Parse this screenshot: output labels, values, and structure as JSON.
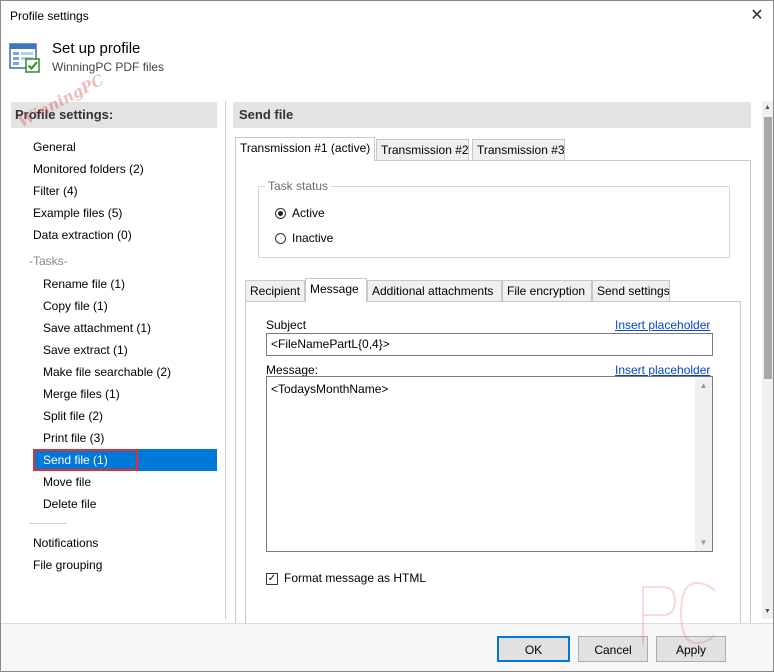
{
  "window": {
    "title": "Profile settings",
    "close_glyph": "✕"
  },
  "header": {
    "title": "Set up profile",
    "subtitle": "WinningPC PDF files",
    "icon": "profile-settings-icon"
  },
  "sidebar": {
    "title": "Profile settings:",
    "watermark": "WinningPC",
    "items": [
      {
        "label": "General"
      },
      {
        "label": "Monitored folders (2)"
      },
      {
        "label": "Filter (4)"
      },
      {
        "label": "Example files (5)"
      },
      {
        "label": "Data extraction (0)"
      }
    ],
    "tasks_label": "-Tasks-",
    "task_items": [
      {
        "label": "Rename file (1)"
      },
      {
        "label": "Copy file (1)"
      },
      {
        "label": "Save attachment (1)"
      },
      {
        "label": "Save extract (1)"
      },
      {
        "label": "Make file searchable (2)"
      },
      {
        "label": "Merge files (1)"
      },
      {
        "label": "Split file (2)"
      },
      {
        "label": "Print file (3)"
      },
      {
        "label": "Send file (1)",
        "selected": true
      },
      {
        "label": "Move file"
      },
      {
        "label": "Delete file"
      }
    ],
    "bottom_items": [
      {
        "label": "Notifications"
      },
      {
        "label": "File grouping"
      }
    ],
    "selection_color": "#0078d7",
    "highlight_color": "#e03030"
  },
  "main": {
    "title": "Send file",
    "tabs": [
      {
        "label": "Transmission #1 (active)",
        "active": true
      },
      {
        "label": "Transmission #2"
      },
      {
        "label": "Transmission #3"
      }
    ],
    "task_status": {
      "legend": "Task status",
      "options": [
        {
          "label": "Active",
          "checked": true
        },
        {
          "label": "Inactive",
          "checked": false
        }
      ]
    },
    "subtabs": [
      {
        "label": "Recipient"
      },
      {
        "label": "Message",
        "active": true
      },
      {
        "label": "Additional attachments"
      },
      {
        "label": "File encryption"
      },
      {
        "label": "Send settings"
      }
    ],
    "message": {
      "subject_label": "Subject",
      "subject_value": "<FileNamePartL{0,4}>",
      "insert_placeholder": "Insert placeholder",
      "message_label": "Message:",
      "message_value": "<TodaysMonthName>",
      "format_html_label": "Format message as HTML",
      "format_html_checked": true
    }
  },
  "buttons": {
    "ok": "OK",
    "cancel": "Cancel",
    "apply": "Apply"
  },
  "watermark_pc": "PC"
}
